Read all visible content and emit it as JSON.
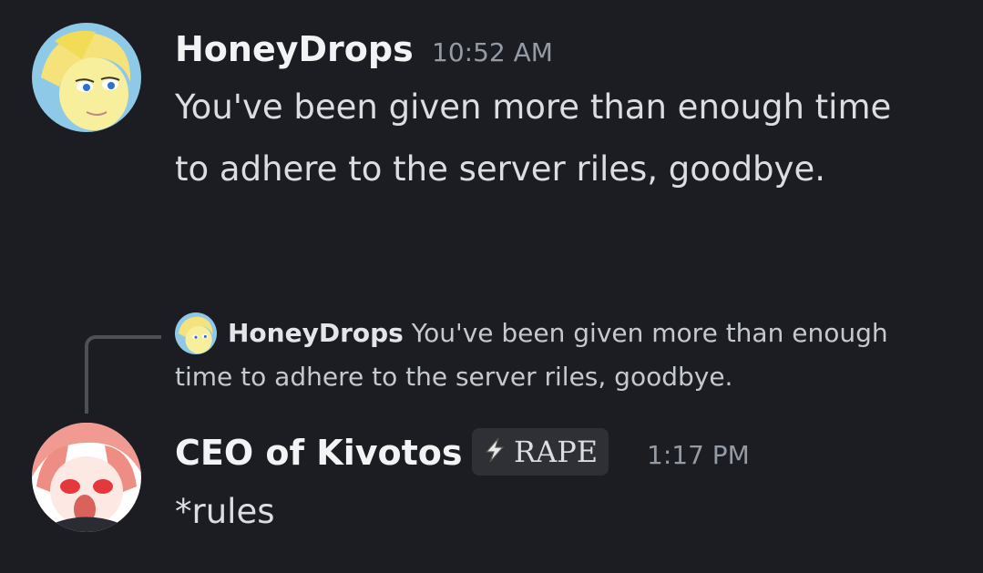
{
  "messages": [
    {
      "author": "HoneyDrops",
      "timestamp": "10:52 AM",
      "content": "You've been given more than enough time to adhere to the server riles, goodbye."
    },
    {
      "author": "CEO of Kivotos",
      "tag": "RAPE",
      "tag_icon": "lightning-bolt-icon",
      "timestamp": "1:17 PM",
      "content": "*rules",
      "reply": {
        "author": "HoneyDrops",
        "content": "You've been given more than enough time to adhere to the server riles, goodbye."
      }
    }
  ],
  "colors": {
    "background": "#1c1d22",
    "username": "#f2f3f5",
    "timestamp": "#949ba4",
    "text": "#dbdee1"
  }
}
